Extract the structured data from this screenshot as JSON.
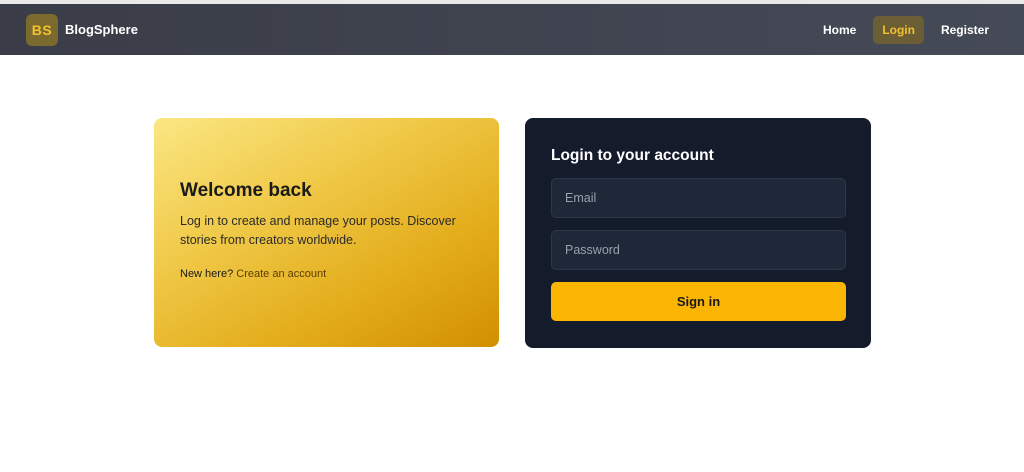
{
  "brand": {
    "logo_text": "BS",
    "name": "BlogSphere"
  },
  "nav": {
    "items": [
      {
        "label": "Home",
        "active": false
      },
      {
        "label": "Login",
        "active": true
      },
      {
        "label": "Register",
        "active": false
      }
    ]
  },
  "welcome": {
    "title": "Welcome back",
    "text": "Log in to create and manage your posts. Discover stories from creators worldwide.",
    "footer_prefix": "New here?",
    "create_link": "Create an account"
  },
  "login": {
    "title": "Login to your account",
    "email_placeholder": "Email",
    "password_placeholder": "Password",
    "submit_label": "Sign in"
  },
  "colors": {
    "navbar": "#3f434e",
    "accent": "#fbb503",
    "login_card": "#141b2b"
  }
}
